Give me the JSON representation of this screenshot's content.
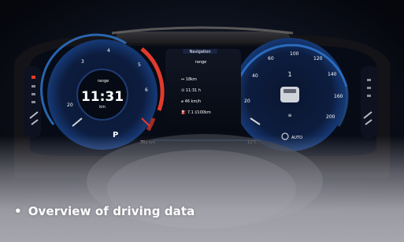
{
  "photo": {
    "subject": "digital cockpit instrument cluster",
    "clock": "11:31",
    "gear": "P"
  },
  "caption": {
    "bullet": "•",
    "text": "Overview of driving data"
  },
  "colors": {
    "background": "#0b0f19",
    "accent_blue": "#2f7bd6",
    "accent_red": "#e23a2e",
    "caption_text": "#ffffff"
  }
}
